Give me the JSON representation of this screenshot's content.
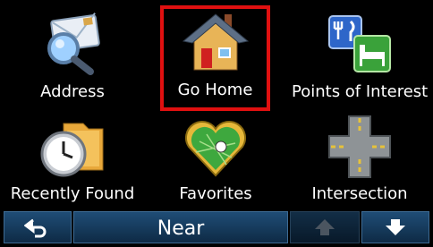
{
  "menu": {
    "items": [
      {
        "label": "Address",
        "icon": "address-icon"
      },
      {
        "label": "Go Home",
        "icon": "house-icon",
        "selected": true
      },
      {
        "label": "Points of Interest",
        "icon": "points-of-interest-icon"
      },
      {
        "label": "Recently Found",
        "icon": "recently-found-icon"
      },
      {
        "label": "Favorites",
        "icon": "favorites-heart-icon"
      },
      {
        "label": "Intersection",
        "icon": "intersection-icon"
      }
    ]
  },
  "bottom_bar": {
    "back_icon": "back-arrow-icon",
    "near_label": "Near",
    "up_icon": "up-arrow-icon",
    "down_icon": "down-arrow-icon"
  },
  "colors": {
    "background": "#000000",
    "selection_outline": "#e01010",
    "bar_button": "#173c5e"
  }
}
